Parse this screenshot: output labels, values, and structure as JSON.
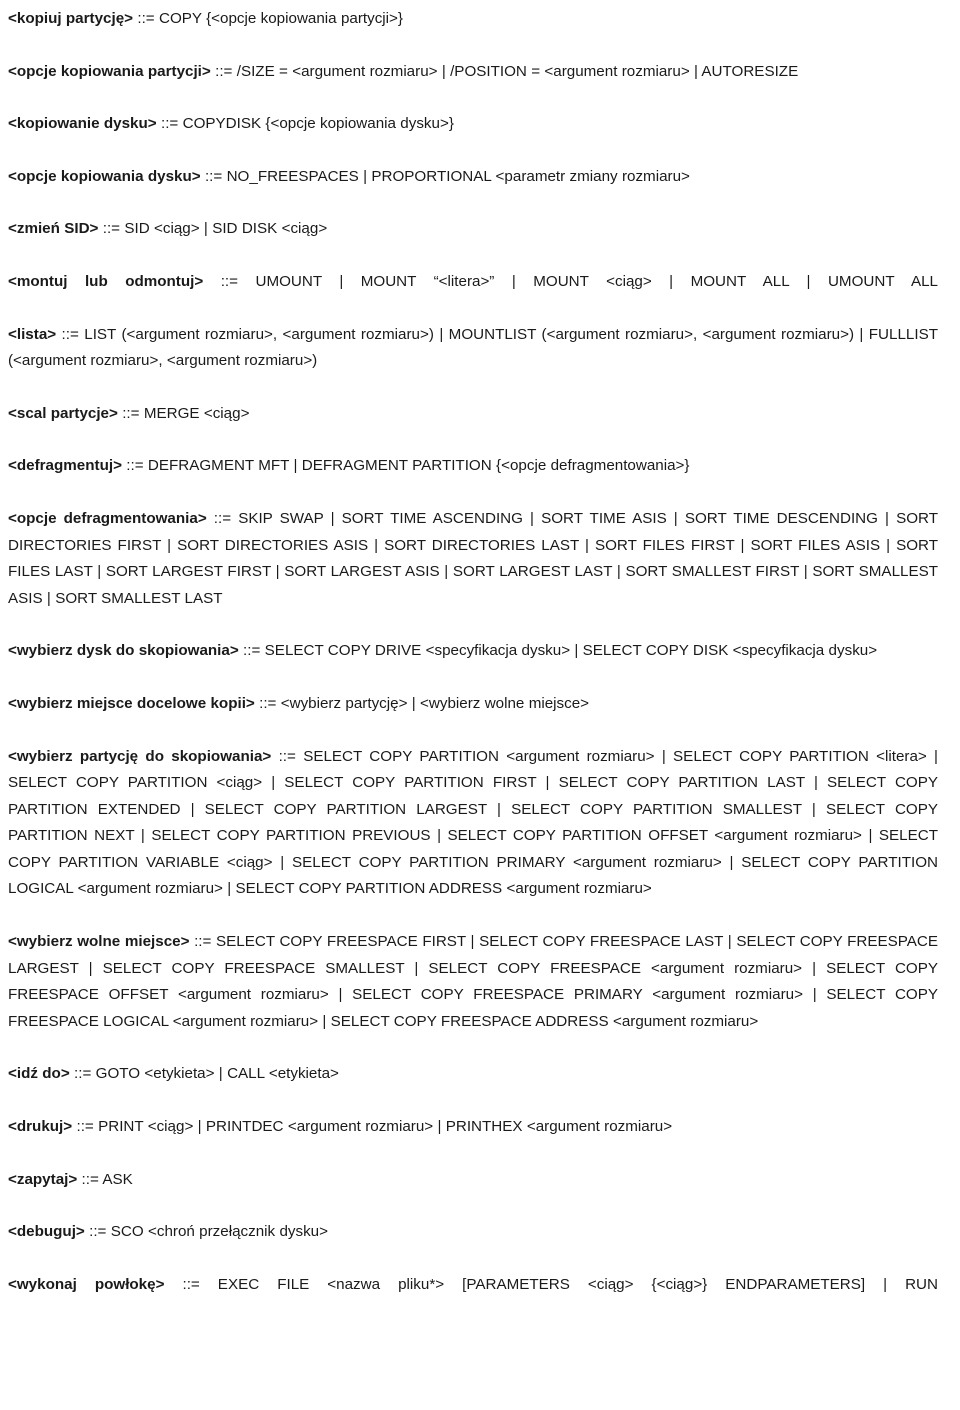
{
  "document": {
    "language": "pl",
    "kind": "bnf-grammar-specification",
    "text_color": "#1a1a1a",
    "background_color": "#ffffff",
    "rules": [
      {
        "id": "kopiuj-partycje",
        "nonterminal": "<kopiuj partycję>",
        "production": " ::= COPY {<opcje kopiowania partycji>}",
        "justify_last_line": false
      },
      {
        "id": "opcje-kopiowania-partycji",
        "nonterminal": "<opcje kopiowania partycji>",
        "production": " ::= /SIZE = <argument rozmiaru> | /POSITION = <argument rozmiaru> | AUTORESIZE",
        "justify_last_line": false
      },
      {
        "id": "kopiowanie-dysku",
        "nonterminal": "<kopiowanie dysku>",
        "production": " ::= COPYDISK {<opcje kopiowania dysku>}",
        "justify_last_line": false
      },
      {
        "id": "opcje-kopiowania-dysku",
        "nonterminal": "<opcje kopiowania dysku>",
        "production": " ::= NO_FREESPACES | PROPORTIONAL <parametr zmiany rozmiaru>",
        "justify_last_line": false
      },
      {
        "id": "zmien-sid",
        "nonterminal": "<zmień SID>",
        "production": " ::= SID <ciąg> | SID DISK <ciąg>",
        "justify_last_line": false
      },
      {
        "id": "montuj-lub-odmontuj",
        "nonterminal": "<montuj lub odmontuj>",
        "production": " ::= UMOUNT | MOUNT “<litera>” | MOUNT <ciąg> | MOUNT ALL | UMOUNT ALL",
        "justify_last_line": true
      },
      {
        "id": "lista",
        "nonterminal": "<lista>",
        "production": " ::= LIST (<argument rozmiaru>, <argument rozmiaru>) | MOUNTLIST (<argument rozmiaru>, <argument rozmiaru>) | FULLLIST (<argument rozmiaru>, <argument rozmiaru>)",
        "justify_last_line": false
      },
      {
        "id": "scal-partycje",
        "nonterminal": "<scal partycje>",
        "production": " ::= MERGE <ciąg>",
        "justify_last_line": false
      },
      {
        "id": "defragmentuj",
        "nonterminal": "<defragmentuj>",
        "production": " ::= DEFRAGMENT MFT | DEFRAGMENT PARTITION {<opcje defragmentowania>}",
        "justify_last_line": false
      },
      {
        "id": "opcje-defragmentowania",
        "nonterminal": "<opcje defragmentowania>",
        "production": " ::= SKIP SWAP | SORT TIME ASCENDING | SORT TIME ASIS | SORT TIME DESCENDING | SORT DIRECTORIES FIRST | SORT DIRECTORIES ASIS | SORT DIRECTORIES LAST | SORT FILES FIRST | SORT FILES ASIS | SORT FILES LAST | SORT LARGEST FIRST | SORT LARGEST ASIS | SORT LARGEST LAST | SORT SMALLEST FIRST | SORT SMALLEST ASIS | SORT SMALLEST LAST",
        "justify_last_line": false
      },
      {
        "id": "wybierz-dysk-do-skopiowania",
        "nonterminal": "<wybierz dysk do skopiowania>",
        "production": " ::= SELECT COPY DRIVE <specyfikacja dysku> | SELECT COPY DISK <specyfikacja dysku>",
        "justify_last_line": false
      },
      {
        "id": "wybierz-miejsce-docelowe-kopii",
        "nonterminal": "<wybierz miejsce docelowe kopii>",
        "production": " ::= <wybierz partycję> | <wybierz wolne miejsce>",
        "justify_last_line": false
      },
      {
        "id": "wybierz-partycje-do-skopiowania",
        "nonterminal": "<wybierz partycję do skopiowania>",
        "production": " ::= SELECT COPY PARTITION <argument rozmiaru> | SELECT COPY PARTITION <litera> | SELECT COPY PARTITION <ciąg> | SELECT COPY PARTITION FIRST | SELECT COPY PARTITION LAST | SELECT COPY PARTITION EXTENDED | SELECT COPY PARTITION LARGEST | SELECT COPY PARTITION SMALLEST | SELECT COPY PARTITION NEXT | SELECT COPY PARTITION PREVIOUS | SELECT COPY PARTITION OFFSET <argument rozmiaru> | SELECT COPY PARTITION VARIABLE <ciąg> | SELECT COPY PARTITION PRIMARY <argument rozmiaru> | SELECT COPY PARTITION LOGICAL <argument rozmiaru> | SELECT COPY PARTITION ADDRESS <argument rozmiaru>",
        "justify_last_line": false
      },
      {
        "id": "wybierz-wolne-miejsce",
        "nonterminal": "<wybierz wolne miejsce>",
        "production": " ::= SELECT COPY FREESPACE FIRST | SELECT COPY FREESPACE LAST | SELECT COPY FREESPACE LARGEST | SELECT COPY FREESPACE SMALLEST | SELECT COPY FREESPACE <argument rozmiaru> | SELECT COPY FREESPACE OFFSET <argument rozmiaru> | SELECT COPY FREESPACE PRIMARY <argument rozmiaru> | SELECT COPY FREESPACE LOGICAL <argument rozmiaru> | SELECT COPY FREESPACE ADDRESS <argument rozmiaru>",
        "justify_last_line": false
      },
      {
        "id": "idz-do",
        "nonterminal": "<idź do>",
        "production": " ::= GOTO <etykieta> | CALL <etykieta>",
        "justify_last_line": false
      },
      {
        "id": "drukuj",
        "nonterminal": "<drukuj>",
        "production": " ::= PRINT <ciąg> | PRINTDEC <argument rozmiaru> | PRINTHEX <argument rozmiaru>",
        "justify_last_line": false
      },
      {
        "id": "zapytaj",
        "nonterminal": "<zapytaj>",
        "production": " ::= ASK",
        "justify_last_line": false
      },
      {
        "id": "debuguj",
        "nonterminal": "<debuguj>",
        "production": " ::= SCO <chroń przełącznik dysku>",
        "justify_last_line": false
      },
      {
        "id": "wykonaj-powloke",
        "nonterminal": "<wykonaj powłokę>",
        "production": " ::= EXEC FILE <nazwa pliku*> [PARAMETERS <ciąg> {<ciąg>} ENDPARAMETERS] | RUN",
        "justify_last_line": true
      }
    ]
  }
}
